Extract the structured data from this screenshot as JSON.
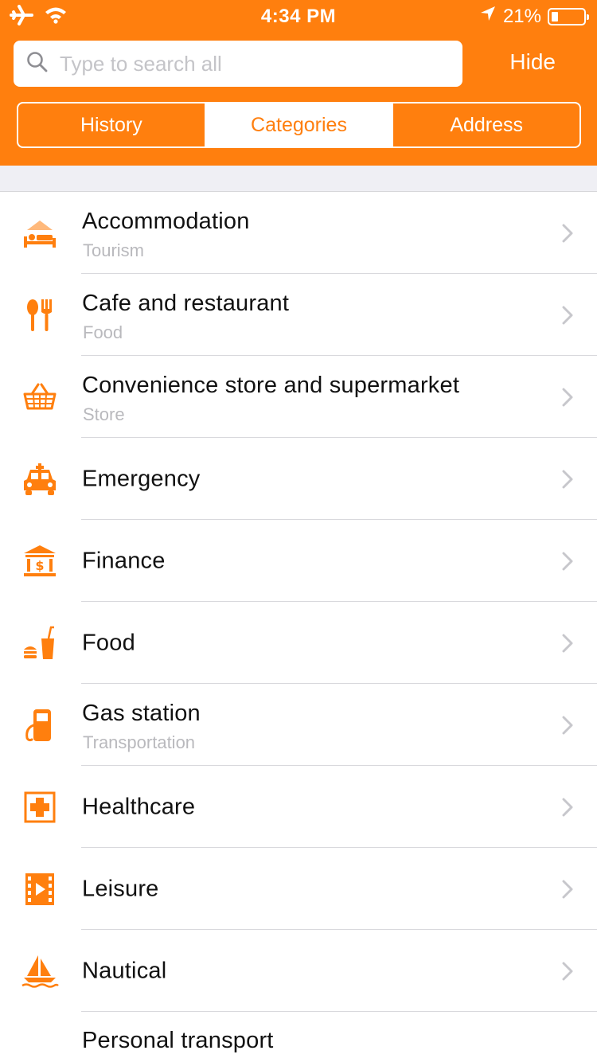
{
  "status": {
    "time": "4:34 PM",
    "battery_text": "21%",
    "battery_level": 0.21,
    "icons": [
      "airplane-icon",
      "wifi-icon",
      "location-arrow-icon",
      "battery-icon"
    ]
  },
  "search": {
    "placeholder": "Type to search all",
    "value": "",
    "hide_label": "Hide"
  },
  "tabs": [
    {
      "label": "History",
      "active": false
    },
    {
      "label": "Categories",
      "active": true
    },
    {
      "label": "Address",
      "active": false
    }
  ],
  "colors": {
    "accent": "#ff7f0e",
    "separator": "#d9d9dd",
    "subtitle": "#b9b9bd",
    "band": "#efeff4"
  },
  "categories": [
    {
      "title": "Accommodation",
      "subtitle": "Tourism",
      "icon": "bed-icon"
    },
    {
      "title": "Cafe and restaurant",
      "subtitle": "Food",
      "icon": "spoon-fork-icon"
    },
    {
      "title": "Convenience store and supermarket",
      "subtitle": "Store",
      "icon": "basket-icon"
    },
    {
      "title": "Emergency",
      "subtitle": "",
      "icon": "ambulance-icon"
    },
    {
      "title": "Finance",
      "subtitle": "",
      "icon": "bank-icon"
    },
    {
      "title": "Food",
      "subtitle": "",
      "icon": "burger-drink-icon"
    },
    {
      "title": "Gas station",
      "subtitle": "Transportation",
      "icon": "fuel-pump-icon"
    },
    {
      "title": "Healthcare",
      "subtitle": "",
      "icon": "first-aid-icon"
    },
    {
      "title": "Leisure",
      "subtitle": "",
      "icon": "film-icon"
    },
    {
      "title": "Nautical",
      "subtitle": "",
      "icon": "sailboat-icon"
    },
    {
      "title": "Personal transport",
      "subtitle": "",
      "icon": "car-icon"
    }
  ]
}
